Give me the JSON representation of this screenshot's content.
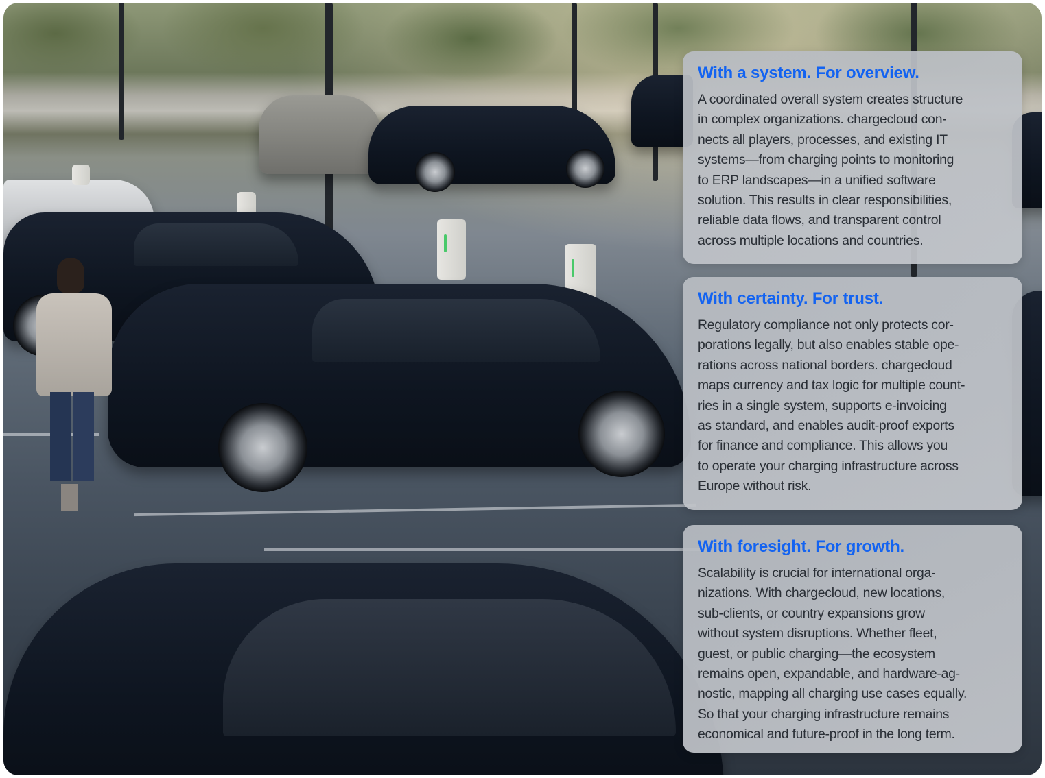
{
  "cards": [
    {
      "heading": "With a system. For overview.",
      "body": "A coordinated overall system creates structure\nin complex organizations. chargecloud con-\nnects all players, processes, and existing IT\nsystems—from charging points to monitoring\nto ERP landscapes—in a unified software\nsolution. This results in clear responsibilities,\nreliable data flows, and transparent control\nacross multiple locations and countries."
    },
    {
      "heading": "With certainty. For trust.",
      "body": "Regulatory compliance not only protects cor-\nporations legally, but also enables stable ope-\nrations across national borders. chargecloud\nmaps currency and tax logic for multiple count-\nries in a single system, supports e-invoicing\nas standard, and enables audit-proof exports\nfor finance and compliance. This allows you\nto operate your charging infrastructure across\nEurope without risk."
    },
    {
      "heading": "With foresight. For growth.",
      "body": "Scalability is crucial for international orga-\nnizations. With chargecloud, new locations,\nsub-clients, or country expansions grow\nwithout system disruptions. Whether fleet,\nguest, or public charging—the ecosystem\nremains open, expandable, and hardware-ag-\nnostic, mapping all charging use cases equally.\nSo that your charging infrastructure remains\neconomical and future-proof in the long term."
    }
  ],
  "colors": {
    "heading": "#1363f1",
    "body_text": "#2a2f36",
    "card_background": "#bcc0c5"
  }
}
